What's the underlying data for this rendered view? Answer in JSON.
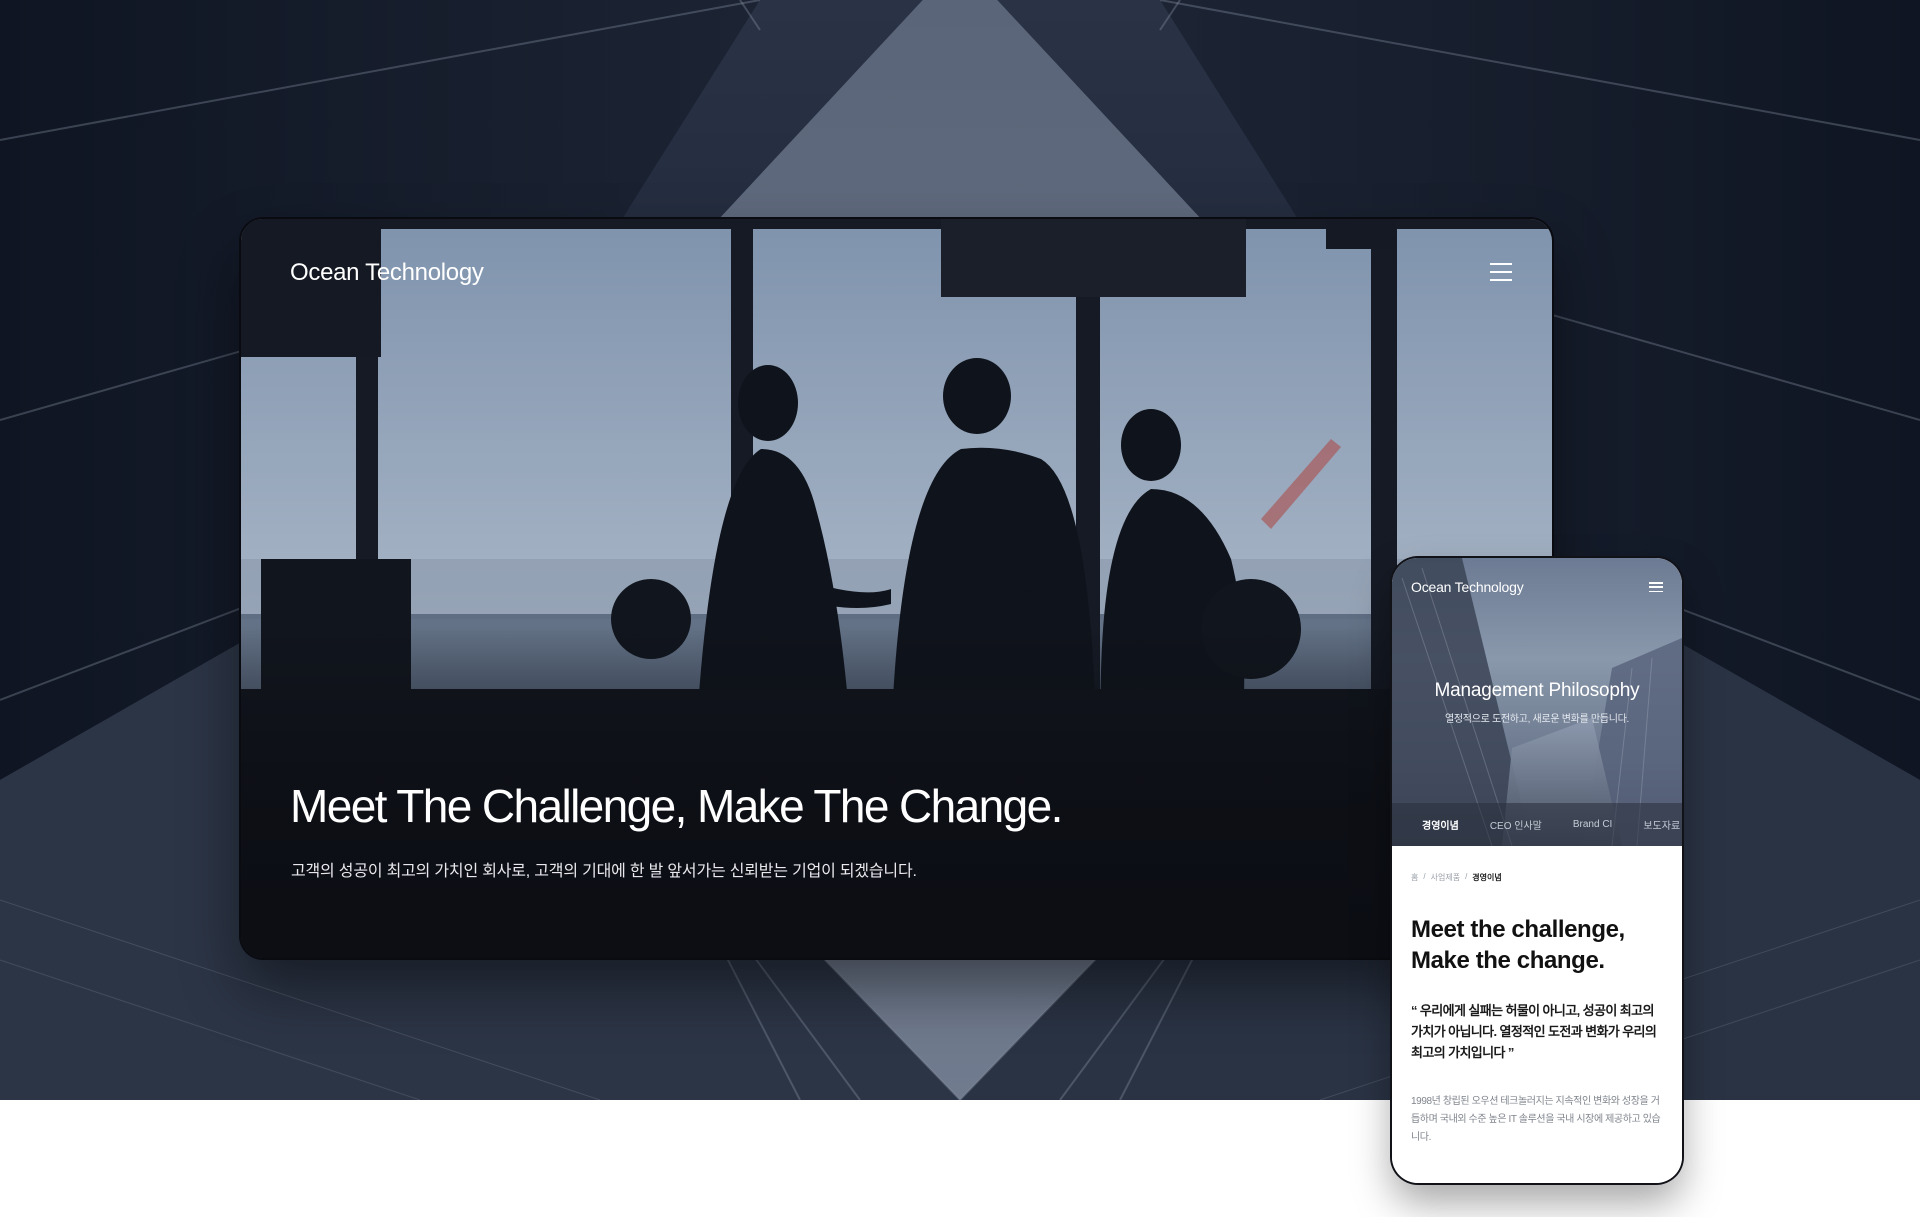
{
  "desktop": {
    "logo": "Ocean Technology",
    "headline": "Meet The Challenge, Make The Change.",
    "subtext": "고객의 성공이 최고의 가치인 회사로, 고객의 기대에 한 발 앞서가는 신뢰받는 기업이 되겠습니다."
  },
  "mobile": {
    "logo": "Ocean Technology",
    "hero_title": "Management Philosophy",
    "hero_tagline": "열정적으로 도전하고, 새로운 변화를 만듭니다.",
    "tabs": [
      {
        "label": "경영이념",
        "active": true
      },
      {
        "label": "CEO 인사말",
        "active": false
      },
      {
        "label": "Brand CI",
        "active": false
      },
      {
        "label": "보도자료",
        "active": false
      }
    ],
    "breadcrumb": [
      "홈",
      "/",
      "사업제품",
      "/",
      "경영이념"
    ],
    "heading_line1": "Meet the challenge,",
    "heading_line2": "Make the change.",
    "quote": "“ 우리에게 실패는 허물이 아니고, 성공이 최고의 가치가 아닙니다. 열정적인 도전과 변화가 우리의 최고의 가치입니다 ”",
    "description": "1998년 창립된 오우션 테크놀러지는 지속적인 변화와 성장을 거듭하며 국내외 수준 높은 IT 솔루션을 국내 시장에 제공하고 있습니다."
  },
  "colors": {
    "background": "#1e2738",
    "desktop_bg": "#0c0e14",
    "text_light": "#ffffff",
    "text_dark": "#111111",
    "text_muted": "#7f848c"
  },
  "icons": [
    "hamburger-menu-icon"
  ]
}
